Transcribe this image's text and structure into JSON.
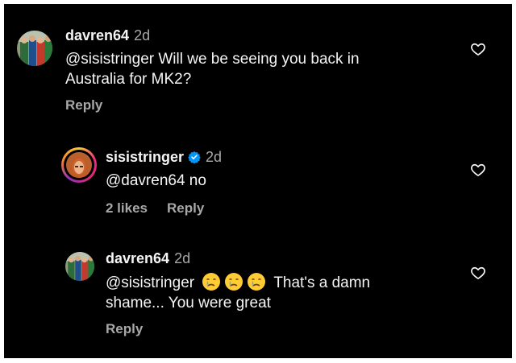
{
  "comments": [
    {
      "username": "davren64",
      "time": "2d",
      "text": "@sisistringer Will we be seeing you back in Australia for MK2?",
      "reply_label": "Reply"
    },
    {
      "username": "sisistringer",
      "time": "2d",
      "text": "@davren64 no",
      "likes": "2 likes",
      "reply_label": "Reply"
    },
    {
      "username": "davren64",
      "time": "2d",
      "mention": "@sisistringer",
      "text_after_emoji": "That's a damn",
      "text_line2": "shame... You were great",
      "reply_label": "Reply"
    }
  ],
  "icons": {
    "like": "heart-outline-icon",
    "verified": "verified-badge-icon",
    "emoji": "crying-face-emoji"
  },
  "colors": {
    "background": "#000000",
    "text_primary": "#f5f5f5",
    "text_secondary": "#a8a8a8",
    "verified": "#0095f6"
  }
}
